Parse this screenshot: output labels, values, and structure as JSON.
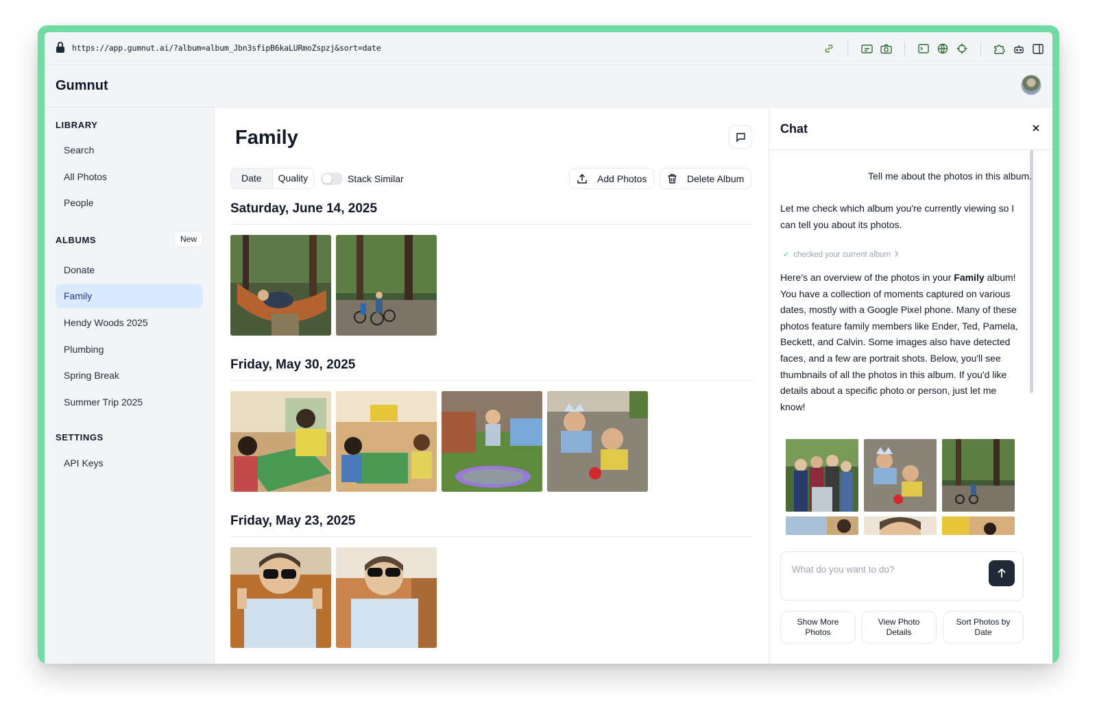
{
  "browser": {
    "url": "https://app.gumnut.ai/?album=album_Jbn3sfipB6kaLURmoZspzj&sort=date",
    "toolbar_icons": [
      "link-icon",
      "screenshot-icon",
      "camera-icon",
      "terminal-icon",
      "globe-icon",
      "crosshair-icon",
      "extension-icon",
      "robot-icon",
      "sidebar-icon"
    ]
  },
  "header": {
    "brand": "Gumnut"
  },
  "sidebar": {
    "library_title": "LIBRARY",
    "library_items": [
      {
        "label": "Search"
      },
      {
        "label": "All Photos"
      },
      {
        "label": "People"
      }
    ],
    "albums_title": "ALBUMS",
    "new_label": "New",
    "album_items": [
      {
        "label": "Donate",
        "active": false
      },
      {
        "label": "Family",
        "active": true
      },
      {
        "label": "Hendy Woods 2025",
        "active": false
      },
      {
        "label": "Plumbing",
        "active": false
      },
      {
        "label": "Spring Break",
        "active": false
      },
      {
        "label": "Summer Trip 2025",
        "active": false
      }
    ],
    "settings_title": "SETTINGS",
    "settings_items": [
      {
        "label": "API Keys"
      }
    ]
  },
  "main": {
    "title": "Family",
    "sort": {
      "date_label": "Date",
      "quality_label": "Quality",
      "selected": "Date"
    },
    "stack_similar": {
      "label": "Stack Similar",
      "on": false
    },
    "add_photos_label": "Add Photos",
    "delete_album_label": "Delete Album",
    "groups": [
      {
        "date": "Saturday, June 14, 2025",
        "photos": [
          "hammock-forest",
          "kids-biking-forest"
        ]
      },
      {
        "date": "Friday, May 30, 2025",
        "photos": [
          "chess-game",
          "board-game-floor",
          "trampoline-jump",
          "chalk-drawing"
        ]
      },
      {
        "date": "Friday, May 23, 2025",
        "photos": [
          "sunglasses-boy-1",
          "sunglasses-boy-2"
        ]
      }
    ]
  },
  "chat": {
    "title": "Chat",
    "user_message": "Tell me about the photos in this album.",
    "assistant_intro": "Let me check which album you're currently viewing so I can tell you about its photos.",
    "tool_call_label": "checked your current album",
    "assistant_summary_pre": "Here's an overview of the photos in your ",
    "assistant_summary_bold": "Family",
    "assistant_summary_post": " album! You have a collection of moments captured on various dates, mostly with a Google Pixel phone. Many of these photos feature family members like Ender, Ted, Pamela, Beckett, and Calvin. Some images also have detected faces, and a few are portrait shots. Below, you'll see thumbnails of all the photos in this album. If you'd like details about a specific photo or person, just let me know!",
    "composer_placeholder": "What do you want to do?",
    "suggestions": [
      "Show More Photos",
      "View Photo Details",
      "Sort Photos by Date"
    ]
  },
  "colors": {
    "accent_active_bg": "#dbeafe",
    "frame_green": "#6fdba2",
    "send_button": "#1f2937"
  }
}
